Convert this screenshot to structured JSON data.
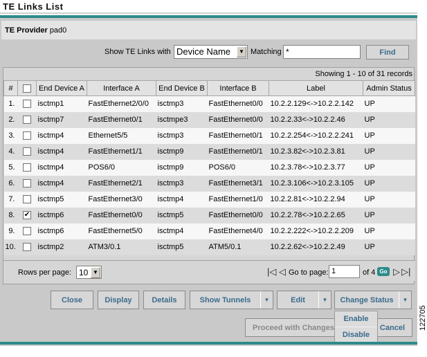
{
  "page": {
    "title": "TE Links List",
    "figure_id": "122705"
  },
  "provider": {
    "label": "TE Provider",
    "value": "pad0"
  },
  "filter": {
    "show_label": "Show TE Links with",
    "field_value": "Device Name",
    "matching_label": "Matching",
    "matching_value": "*",
    "find_label": "Find"
  },
  "table": {
    "showing": "Showing 1 - 10 of 31 records",
    "headers": [
      "#",
      "",
      "End Device A",
      "Interface A",
      "End Device B",
      "Interface B",
      "Label",
      "Admin Status"
    ],
    "rows": [
      {
        "num": "1.",
        "checked": false,
        "end_a": "isctmp1",
        "intf_a": "FastEthernet2/0/0",
        "end_b": "isctmp3",
        "intf_b": "FastEthernet0/0",
        "label": "10.2.2.129<->10.2.2.142",
        "status": "UP"
      },
      {
        "num": "2.",
        "checked": false,
        "end_a": "isctmp7",
        "intf_a": "FastEthernet0/1",
        "end_b": "isctmpe3",
        "intf_b": "FastEthernet0/0",
        "label": "10.2.2.33<->10.2.2.46",
        "status": "UP"
      },
      {
        "num": "3.",
        "checked": false,
        "end_a": "isctmp4",
        "intf_a": "Ethernet5/5",
        "end_b": "isctmp3",
        "intf_b": "FastEthernet0/1",
        "label": "10.2.2.254<->10.2.2.241",
        "status": "UP"
      },
      {
        "num": "4.",
        "checked": false,
        "end_a": "isctmp4",
        "intf_a": "FastEthernet1/1",
        "end_b": "isctmp9",
        "intf_b": "FastEthernet0/1",
        "label": "10.2.3.82<->10.2.3.81",
        "status": "UP"
      },
      {
        "num": "5.",
        "checked": false,
        "end_a": "isctmp4",
        "intf_a": "POS6/0",
        "end_b": "isctmp9",
        "intf_b": "POS6/0",
        "label": "10.2.3.78<->10.2.3.77",
        "status": "UP"
      },
      {
        "num": "6.",
        "checked": false,
        "end_a": "isctmp4",
        "intf_a": "FastEthernet2/1",
        "end_b": "isctmp3",
        "intf_b": "FastEthernet3/1",
        "label": "10.2.3.106<->10.2.3.105",
        "status": "UP"
      },
      {
        "num": "7.",
        "checked": false,
        "end_a": "isctmp5",
        "intf_a": "FastEthernet3/0",
        "end_b": "isctmp4",
        "intf_b": "FastEthernet1/0",
        "label": "10.2.2.81<->10.2.2.94",
        "status": "UP"
      },
      {
        "num": "8.",
        "checked": true,
        "end_a": "isctmp6",
        "intf_a": "FastEthernet0/0",
        "end_b": "isctmp5",
        "intf_b": "FastEthernet0/0",
        "label": "10.2.2.78<->10.2.2.65",
        "status": "UP"
      },
      {
        "num": "9.",
        "checked": false,
        "end_a": "isctmp6",
        "intf_a": "FastEthernet5/0",
        "end_b": "isctmp4",
        "intf_b": "FastEthernet4/0",
        "label": "10.2.2.222<->10.2.2.209",
        "status": "UP"
      },
      {
        "num": "10.",
        "checked": false,
        "end_a": "isctmp2",
        "intf_a": "ATM3/0.1",
        "end_b": "isctmp5",
        "intf_b": "ATM5/0.1",
        "label": "10.2.2.62<->10.2.2.49",
        "status": "UP"
      }
    ]
  },
  "pager": {
    "rows_per_page_label": "Rows per page:",
    "rows_per_page": "10",
    "goto_label": "Go to page:",
    "page": "1",
    "of_label": "of 4",
    "go_label": "Go"
  },
  "actions": {
    "close": "Close",
    "display": "Display",
    "details": "Details",
    "show_tunnels": "Show Tunnels",
    "edit": "Edit",
    "change_status": "Change Status",
    "proceed": "Proceed with Changes",
    "cancel": "Cancel"
  },
  "change_status_menu": [
    "Enable",
    "Disable"
  ]
}
